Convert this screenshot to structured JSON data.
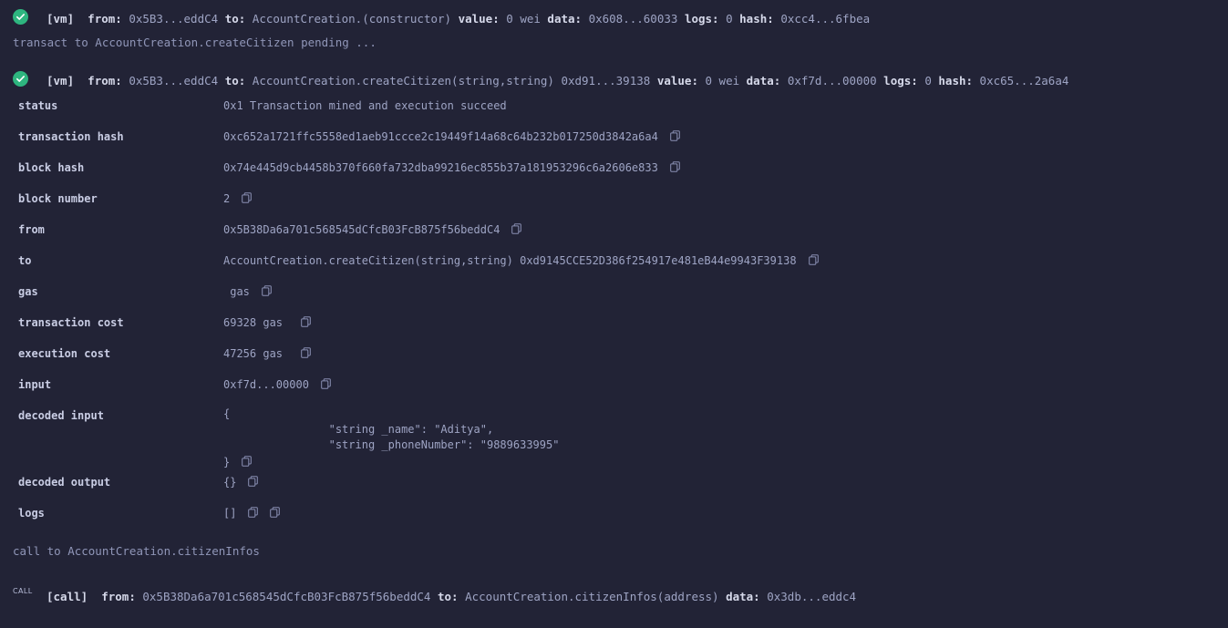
{
  "terminal": {
    "entries": [
      {
        "icon": "check-circle-icon",
        "segments": [
          {
            "t": "[vm] ",
            "bold": true
          },
          {
            "t": " from: ",
            "bold": true
          },
          {
            "t": "0x5B3...eddC4 ",
            "bold": false
          },
          {
            "t": "to: ",
            "bold": true
          },
          {
            "t": "AccountCreation.(constructor) ",
            "bold": false
          },
          {
            "t": "value: ",
            "bold": true
          },
          {
            "t": "0 wei ",
            "bold": false
          },
          {
            "t": "data: ",
            "bold": true
          },
          {
            "t": "0x608...60033 ",
            "bold": false
          },
          {
            "t": "logs: ",
            "bold": true
          },
          {
            "t": "0 ",
            "bold": false
          },
          {
            "t": "hash: ",
            "bold": true
          },
          {
            "t": "0xcc4...6fbea",
            "bold": false
          }
        ]
      }
    ],
    "pending_line": "transact to AccountCreation.createCitizen pending ...",
    "call_line": "call to AccountCreation.citizenInfos",
    "tx_header": {
      "icon": "check-circle-icon",
      "segments": [
        {
          "t": "[vm] ",
          "bold": true
        },
        {
          "t": " from: ",
          "bold": true
        },
        {
          "t": "0x5B3...eddC4 ",
          "bold": false
        },
        {
          "t": "to: ",
          "bold": true
        },
        {
          "t": "AccountCreation.createCitizen(string,string) 0xd91...39138 ",
          "bold": false
        },
        {
          "t": "value: ",
          "bold": true
        },
        {
          "t": "0 wei ",
          "bold": false
        },
        {
          "t": "data: ",
          "bold": true
        },
        {
          "t": "0xf7d...00000 ",
          "bold": false
        },
        {
          "t": "logs: ",
          "bold": true
        },
        {
          "t": "0 ",
          "bold": false
        },
        {
          "t": "hash: ",
          "bold": true
        },
        {
          "t": "0xc65...2a6a4",
          "bold": false
        }
      ]
    },
    "call_header": {
      "badge": "CALL",
      "segments": [
        {
          "t": "[call] ",
          "bold": true
        },
        {
          "t": " from: ",
          "bold": true
        },
        {
          "t": "0x5B38Da6a701c568545dCfcB03FcB875f56beddC4 ",
          "bold": false
        },
        {
          "t": "to: ",
          "bold": true
        },
        {
          "t": "AccountCreation.citizenInfos(address) ",
          "bold": false
        },
        {
          "t": "data: ",
          "bold": true
        },
        {
          "t": "0x3db...eddc4",
          "bold": false
        }
      ]
    },
    "details": [
      {
        "label": "status",
        "value": "0x1 Transaction mined and execution succeed",
        "copies": 0
      },
      {
        "label": "transaction hash",
        "value": "0xc652a1721ffc5558ed1aeb91ccce2c19449f14a68c64b232b017250d3842a6a4",
        "copies": 1
      },
      {
        "label": "block hash",
        "value": "0x74e445d9cb4458b370f660fa732dba99216ec855b37a181953296c6a2606e833",
        "copies": 1
      },
      {
        "label": "block number",
        "value": "2",
        "copies": 1
      },
      {
        "label": "from",
        "value": "0x5B38Da6a701c568545dCfcB03FcB875f56beddC4",
        "copies": 1
      },
      {
        "label": "to",
        "value": "AccountCreation.createCitizen(string,string) 0xd9145CCE52D386f254917e481eB44e9943F39138",
        "copies": 1
      },
      {
        "label": "gas",
        "value": " gas",
        "copies": 1
      },
      {
        "label": "transaction cost",
        "value": "69328 gas ",
        "copies": 1
      },
      {
        "label": "execution cost",
        "value": "47256 gas ",
        "copies": 1
      },
      {
        "label": "input",
        "value": "0xf7d...00000",
        "copies": 1
      },
      {
        "label": "decoded input",
        "value": "{\n\t\t\"string _name\": \"Aditya\",\n\t\t\"string _phoneNumber\": \"9889633995\"\n}",
        "multiline": true,
        "copies": 1
      },
      {
        "label": "decoded output",
        "value": "{}",
        "copies": 1
      },
      {
        "label": "logs",
        "value": "[]",
        "copies": 2
      }
    ]
  },
  "colors": {
    "background": "#222336",
    "text": "#9ea4c4",
    "label": "#c9cde4",
    "success": "#2eb57f",
    "icon": "#8a90b4"
  }
}
